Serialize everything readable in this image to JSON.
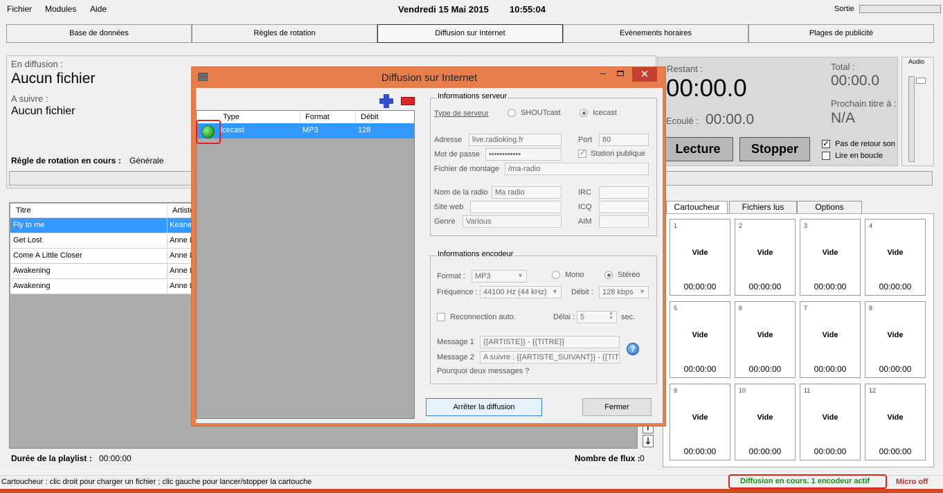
{
  "menu": {
    "items": [
      "Fichier",
      "Modules",
      "Aide"
    ],
    "clock_date": "Vendredi 15 Mai 2015",
    "clock_time": "10:55:04",
    "sortie_label": "Sortie"
  },
  "tabs": [
    "Base de données",
    "Règles de rotation",
    "Diffusion sur Internet",
    "Evènements horaires",
    "Plages de publicité"
  ],
  "info": {
    "en_diffusion_label": "En diffusion :",
    "en_diffusion_value": "Aucun fichier",
    "a_suivre_label": "A suivre :",
    "a_suivre_value": "Aucun fichier",
    "regle_label": "Règle de rotation en cours :",
    "regle_value": "Générale"
  },
  "player": {
    "restant_label": "Restant :",
    "restant_value": "00:00.0",
    "ecoule_label": "Ecoulé :",
    "ecoule_value": "00:00.0",
    "total_label": "Total :",
    "total_value": "00:00.0",
    "prochain_label": "Prochain titre à :",
    "prochain_value": "N/A",
    "lecture_label": "Lecture",
    "stopper_label": "Stopper",
    "pas_retour_label": "Pas de retour son",
    "pas_retour_checked": true,
    "boucle_label": "Lire en boucle",
    "boucle_checked": false,
    "audio_label": "Audio"
  },
  "playlist": {
    "columns": [
      "Titre",
      "Artiste"
    ],
    "rows": [
      {
        "title": "Fly to me",
        "artist": "Keane",
        "selected": true
      },
      {
        "title": "Get Lost",
        "artist": "Anne L",
        "selected": false
      },
      {
        "title": "Come A Little Closer",
        "artist": "Anne L",
        "selected": false
      },
      {
        "title": "Awakening",
        "artist": "Anne L",
        "selected": false
      },
      {
        "title": "Awakening",
        "artist": "Anne L",
        "selected": false
      }
    ],
    "duree_label": "Durée de la playlist :",
    "duree_value": "00:00:00",
    "flux_label": "Nombre de flux :",
    "flux_value": "0"
  },
  "cart": {
    "tabs": [
      "Cartoucheur",
      "Fichiers lus",
      "Options"
    ],
    "slots": [
      {
        "num": "1",
        "label": "Vide",
        "time": "00:00:00"
      },
      {
        "num": "2",
        "label": "Vide",
        "time": "00:00:00"
      },
      {
        "num": "3",
        "label": "Vide",
        "time": "00:00:00"
      },
      {
        "num": "4",
        "label": "Vide",
        "time": "00:00:00"
      },
      {
        "num": "5",
        "label": "Vide",
        "time": "00:00:00"
      },
      {
        "num": "6",
        "label": "Vide",
        "time": "00:00:00"
      },
      {
        "num": "7",
        "label": "Vide",
        "time": "00:00:00"
      },
      {
        "num": "8",
        "label": "Vide",
        "time": "00:00:00"
      },
      {
        "num": "9",
        "label": "Vide",
        "time": "00:00:00"
      },
      {
        "num": "10",
        "label": "Vide",
        "time": "00:00:00"
      },
      {
        "num": "11",
        "label": "Vide",
        "time": "00:00:00"
      },
      {
        "num": "12",
        "label": "Vide",
        "time": "00:00:00"
      }
    ]
  },
  "status": {
    "hint": "Cartoucheur : clic droit pour charger un fichier ; clic gauche pour lancer/stopper la cartouche",
    "diffusion": "Diffusion en cours. 1 encodeur actif",
    "micro": "Micro off"
  },
  "dialog": {
    "title": "Diffusion sur Internet",
    "list_columns": [
      "Type",
      "Format",
      "Débit"
    ],
    "list_rows": [
      {
        "type": "Icecast",
        "format": "MP3",
        "debit": "128",
        "status": "active"
      }
    ],
    "server": {
      "group_title": "Informations serveur",
      "type_label": "Type de serveur",
      "shoutcast_label": "SHOUTcast",
      "icecast_label": "Icecast",
      "selected_type": "Icecast",
      "adresse_label": "Adresse",
      "adresse_value": "live.radioking.fr",
      "port_label": "Port",
      "port_value": "80",
      "mdp_label": "Mot de passe",
      "mdp_value": "••••••••••••",
      "station_label": "Station publique",
      "station_checked": true,
      "montage_label": "Fichier de montage",
      "montage_value": "/ma-radio",
      "nom_label": "Nom de la radio",
      "nom_value": "Ma radio",
      "irc_label": "IRC",
      "irc_value": "",
      "site_label": "Site web",
      "site_value": "",
      "icq_label": "ICQ",
      "icq_value": "",
      "genre_label": "Genre",
      "genre_value": "Various",
      "aim_label": "AIM",
      "aim_value": ""
    },
    "encoder": {
      "group_title": "Informations encodeur",
      "format_label": "Format :",
      "format_value": "MP3",
      "mono_label": "Mono",
      "stereo_label": "Stéréo",
      "selected_channels": "Stéréo",
      "freq_label": "Fréquence :",
      "freq_value": "44100 Hz (44 kHz)",
      "debit_label": "Débit :",
      "debit_value": "128 kbps",
      "reconnect_label": "Reconnection auto.",
      "reconnect_checked": false,
      "delai_label": "Délai :",
      "delai_value": "5",
      "delai_unit": "sec.",
      "msg1_label": "Message 1",
      "msg1_value": "{{ARTISTE}} - {{TITRE}}",
      "msg2_label": "Message 2",
      "msg2_value": "A suivre : {{ARTISTE_SUIVANT}} - {{TIT",
      "pourquoi_label": "Pourquoi deux messages ?"
    },
    "arreter_label": "Arrêter la diffusion",
    "fermer_label": "Fermer"
  }
}
